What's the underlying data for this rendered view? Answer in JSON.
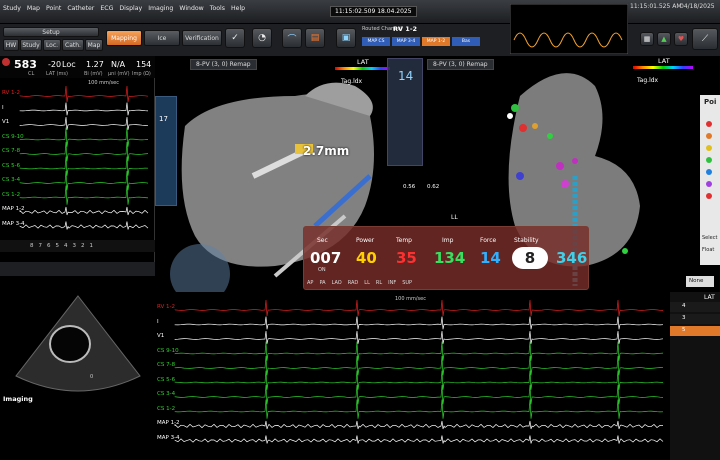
{
  "menu": {
    "items": [
      "Study",
      "Map",
      "Point",
      "Catheter",
      "ECG",
      "Display",
      "Imaging",
      "Window",
      "Tools",
      "Help"
    ],
    "center_clock": "11:15:02.509  18.04.2025",
    "right_clock": "11:15:01.525 AM",
    "right_date": "04/18/2025"
  },
  "toolbar": {
    "setup": "Setup",
    "tabs": [
      "HW",
      "Study",
      "Loc.",
      "Cath.",
      "Map"
    ],
    "mapping": "Mapping",
    "ice": "Ice",
    "verification": "Verification",
    "routed_channel_label": "Routed Channel",
    "routed_channel_value": "RV 1-2",
    "channel_chips": [
      "MAP CS",
      "MAP 3-4",
      "MAP 1-2",
      "Bas"
    ]
  },
  "vitals": {
    "cl": "583",
    "cl_unit": "CL",
    "lat": "-20",
    "lat_unit": "LAT (ms)",
    "loc": "Loc",
    "bi": "1.27",
    "bi_unit": "Bi (mV)",
    "uni": "N/A",
    "uni_unit": "µni (mV)",
    "imp": "154",
    "imp_unit": "Imp (Ω)"
  },
  "left_egm": {
    "speed": "100 mm/sec",
    "channels": [
      {
        "name": "RV 1-2",
        "color": "#e02020"
      },
      {
        "name": "I",
        "color": "#ffffff"
      },
      {
        "name": "V1",
        "color": "#ffffff"
      },
      {
        "name": "CS 9-10",
        "color": "#2ed12e"
      },
      {
        "name": "CS 7-8",
        "color": "#2ed12e"
      },
      {
        "name": "CS 5-6",
        "color": "#2ed12e"
      },
      {
        "name": "CS 3-4",
        "color": "#2ed12e"
      },
      {
        "name": "CS 1-2",
        "color": "#2ed12e"
      },
      {
        "name": "MAP 1-2",
        "color": "#ffffff"
      },
      {
        "name": "MAP 3-4",
        "color": "#ffffff"
      }
    ],
    "scale": [
      "8",
      "7",
      "6",
      "5",
      "4",
      "3",
      "2",
      "1"
    ]
  },
  "map": {
    "left_title": "8-PV (3, 0) Remap",
    "right_title": "8-PV (3, 0) Remap",
    "lat_label": "LAT",
    "tag_label": "Tag.ldx",
    "distance": "2.7mm",
    "pair_count": "14",
    "slice_a": "0.56",
    "slice_b": "0.62",
    "ll_label": "LL",
    "side_number": "17"
  },
  "ablation": {
    "sec_label": "Sec",
    "sec_value": "007",
    "sec_sub": "ON",
    "power_label": "Power",
    "power_value": "40",
    "temp_label": "Temp",
    "temp_value": "35",
    "imp_label": "Imp",
    "imp_value": "134",
    "force_label": "Force",
    "force_value": "14",
    "stability_label": "Stability",
    "stability_value": "8",
    "extra_value": "346",
    "footer": [
      "AP",
      "PA",
      "LAO",
      "RAD",
      "LL",
      "RL",
      "INF",
      "SUP"
    ]
  },
  "imaging": {
    "label": "Imaging",
    "marker": "0"
  },
  "bottom_egm": {
    "speed": "100 mm/sec",
    "channels": [
      {
        "name": "RV 1-2",
        "color": "#e02020"
      },
      {
        "name": "I",
        "color": "#ffffff"
      },
      {
        "name": "V1",
        "color": "#ffffff"
      },
      {
        "name": "CS 9-10",
        "color": "#2ed12e"
      },
      {
        "name": "CS 7-8",
        "color": "#2ed12e"
      },
      {
        "name": "CS 5-6",
        "color": "#2ed12e"
      },
      {
        "name": "CS 3-4",
        "color": "#2ed12e"
      },
      {
        "name": "CS 1-2",
        "color": "#2ed12e"
      },
      {
        "name": "MAP 1-2",
        "color": "#ffffff"
      },
      {
        "name": "MAP 3-4",
        "color": "#ffffff"
      }
    ]
  },
  "right_panel": {
    "points_title": "Poi",
    "select_label": "Select",
    "float_label": "Float",
    "none_select": "None",
    "lat_header": "LAT",
    "rows": [
      "4",
      "3",
      "5"
    ]
  },
  "colors": {
    "accent_orange": "#e8742e",
    "ecg_green": "#2ed12e",
    "ecg_red": "#e02020",
    "power_yellow": "#ffd000",
    "temp_red": "#ff3030",
    "imp_green": "#38e060",
    "force_blue": "#30b0ff",
    "stability_white": "#ffffff"
  }
}
